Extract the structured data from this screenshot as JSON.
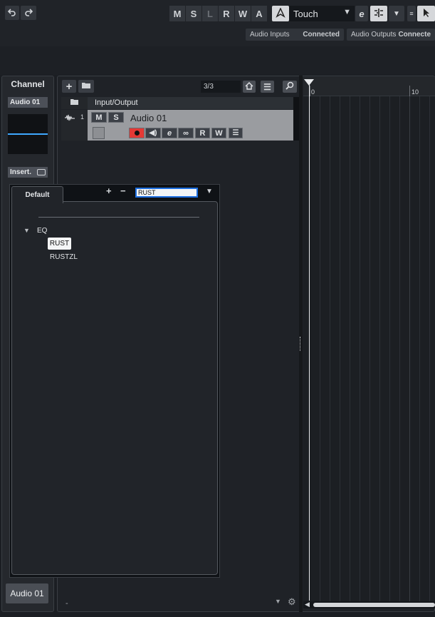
{
  "toolbar": {
    "undo_icon": "undo-icon",
    "redo_icon": "redo-icon",
    "mode_buttons": [
      "M",
      "S",
      "L",
      "R",
      "W",
      "A"
    ],
    "automation_mode": "Touch",
    "ports": {
      "audio_inputs_label": "Audio Inputs",
      "audio_inputs_status": "Connected",
      "audio_outputs_label": "Audio Outputs",
      "audio_outputs_status": "Connecte"
    }
  },
  "inspector": {
    "title": "Channel",
    "channel_name": "Audio 01",
    "inserts_label": "Insert.",
    "bottom_channel_name": "Audio 01"
  },
  "track_list": {
    "counter": "3/3",
    "folder_name": "Input/Output",
    "track": {
      "number": "1",
      "mute": "M",
      "solo": "S",
      "name": "Audio 01",
      "read": "R",
      "write": "W"
    }
  },
  "ruler": {
    "marks": [
      "0",
      "10"
    ]
  },
  "preset_popup": {
    "tab_label": "Default",
    "add_label": "+",
    "remove_label": "−",
    "search_value": "RUST",
    "category": "EQ",
    "results": [
      "RUST",
      "RUSTZL"
    ],
    "selected_index": 0
  },
  "footer": {
    "dash": "-"
  },
  "colors": {
    "record_red": "#e53935",
    "meter_blue": "#3ea8ff",
    "selection_border": "#1e6fe0"
  }
}
